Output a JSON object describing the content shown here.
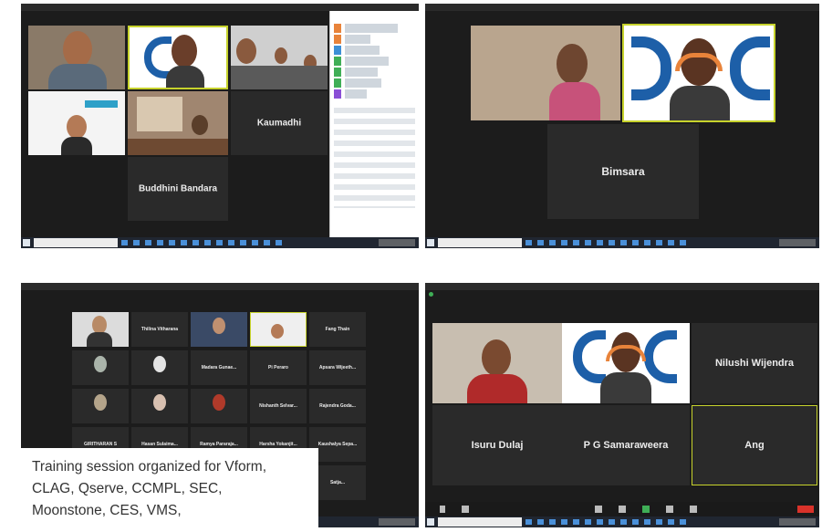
{
  "caption": {
    "line1": "Training session organized for Vform,",
    "line2": "CLAG, Qserve, CCMPL, SEC,",
    "line3": "Moonstone, CES, VMS,"
  },
  "shot1": {
    "names": [
      "Kaumadhi",
      "Buddhini Bandara"
    ]
  },
  "shot2": {
    "names": [
      "Bimsara"
    ]
  },
  "shot3": {
    "names": [
      "Thilina Vitharana",
      "Fang Thain",
      "Madara Gunae...",
      "Pi Peraro",
      "Apsara Wijeeth...",
      "Nishanth Selvar...",
      "Rajendra Goda...",
      "GIRITHARAN S",
      "Hasan Sulaima...",
      "Ramya Pararaja...",
      "Harsha Yokanjit...",
      "Kaushalya Sepa...",
      "Satja..."
    ]
  },
  "shot4": {
    "names": [
      "Nilushi Wijendra",
      "Isuru Dulaj",
      "P G Samaraweera",
      "Ang"
    ]
  },
  "colors": {
    "zoom_bg": "#1c1c1c",
    "tile": "#2a2a2a",
    "active_border": "#c7d32c",
    "brand_blue": "#1d5fa8"
  }
}
